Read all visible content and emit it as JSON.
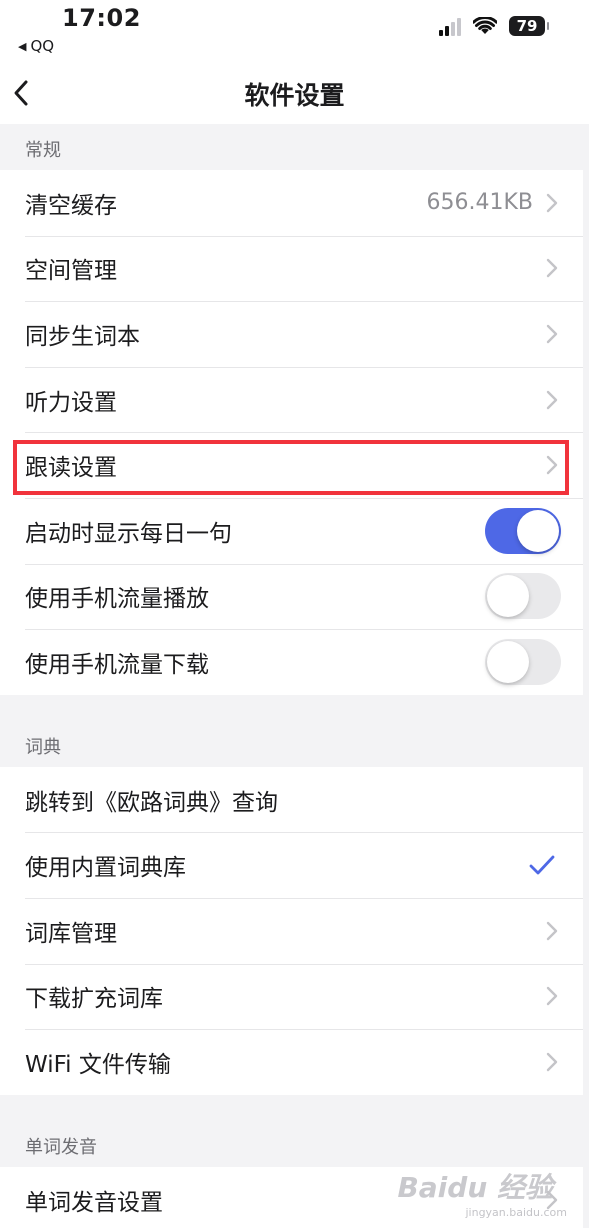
{
  "status_bar": {
    "time": "17:02",
    "back_app": "QQ",
    "battery": "79"
  },
  "nav": {
    "title": "软件设置"
  },
  "sections": {
    "general": {
      "header": "常规",
      "clear_cache": {
        "label": "清空缓存",
        "value": "656.41KB"
      },
      "space_manage": {
        "label": "空间管理"
      },
      "sync_wordbook": {
        "label": "同步生词本"
      },
      "listening": {
        "label": "听力设置"
      },
      "follow_read": {
        "label": "跟读设置"
      },
      "daily_sentence": {
        "label": "启动时显示每日一句",
        "enabled": true
      },
      "mobile_play": {
        "label": "使用手机流量播放",
        "enabled": false
      },
      "mobile_download": {
        "label": "使用手机流量下载",
        "enabled": false
      }
    },
    "dictionary": {
      "header": "词典",
      "jump_eudic": {
        "label": "跳转到《欧路词典》查询"
      },
      "builtin_dict": {
        "label": "使用内置词典库",
        "checked": true
      },
      "dict_manage": {
        "label": "词库管理"
      },
      "download_ext": {
        "label": "下载扩充词库"
      },
      "wifi_transfer": {
        "label": "WiFi 文件传输"
      }
    },
    "pronunciation": {
      "header": "单词发音",
      "pron_settings": {
        "label": "单词发音设置"
      }
    }
  },
  "colors": {
    "accent": "#4e68e6",
    "highlight": "#f1333c",
    "background": "#f3f3f5"
  },
  "watermark": {
    "text": "Baidu 经验",
    "sub": "jingyan.baidu.com"
  }
}
